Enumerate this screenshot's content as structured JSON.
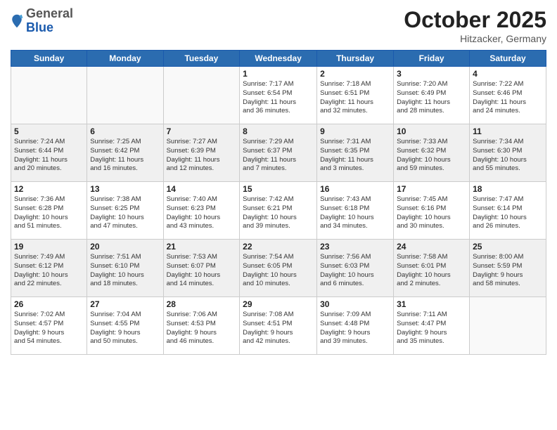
{
  "header": {
    "logo": {
      "general": "General",
      "blue": "Blue"
    },
    "month": "October 2025",
    "location": "Hitzacker, Germany"
  },
  "weekdays": [
    "Sunday",
    "Monday",
    "Tuesday",
    "Wednesday",
    "Thursday",
    "Friday",
    "Saturday"
  ],
  "weeks": [
    [
      {
        "day": "",
        "info": ""
      },
      {
        "day": "",
        "info": ""
      },
      {
        "day": "",
        "info": ""
      },
      {
        "day": "1",
        "info": "Sunrise: 7:17 AM\nSunset: 6:54 PM\nDaylight: 11 hours\nand 36 minutes."
      },
      {
        "day": "2",
        "info": "Sunrise: 7:18 AM\nSunset: 6:51 PM\nDaylight: 11 hours\nand 32 minutes."
      },
      {
        "day": "3",
        "info": "Sunrise: 7:20 AM\nSunset: 6:49 PM\nDaylight: 11 hours\nand 28 minutes."
      },
      {
        "day": "4",
        "info": "Sunrise: 7:22 AM\nSunset: 6:46 PM\nDaylight: 11 hours\nand 24 minutes."
      }
    ],
    [
      {
        "day": "5",
        "info": "Sunrise: 7:24 AM\nSunset: 6:44 PM\nDaylight: 11 hours\nand 20 minutes."
      },
      {
        "day": "6",
        "info": "Sunrise: 7:25 AM\nSunset: 6:42 PM\nDaylight: 11 hours\nand 16 minutes."
      },
      {
        "day": "7",
        "info": "Sunrise: 7:27 AM\nSunset: 6:39 PM\nDaylight: 11 hours\nand 12 minutes."
      },
      {
        "day": "8",
        "info": "Sunrise: 7:29 AM\nSunset: 6:37 PM\nDaylight: 11 hours\nand 7 minutes."
      },
      {
        "day": "9",
        "info": "Sunrise: 7:31 AM\nSunset: 6:35 PM\nDaylight: 11 hours\nand 3 minutes."
      },
      {
        "day": "10",
        "info": "Sunrise: 7:33 AM\nSunset: 6:32 PM\nDaylight: 10 hours\nand 59 minutes."
      },
      {
        "day": "11",
        "info": "Sunrise: 7:34 AM\nSunset: 6:30 PM\nDaylight: 10 hours\nand 55 minutes."
      }
    ],
    [
      {
        "day": "12",
        "info": "Sunrise: 7:36 AM\nSunset: 6:28 PM\nDaylight: 10 hours\nand 51 minutes."
      },
      {
        "day": "13",
        "info": "Sunrise: 7:38 AM\nSunset: 6:25 PM\nDaylight: 10 hours\nand 47 minutes."
      },
      {
        "day": "14",
        "info": "Sunrise: 7:40 AM\nSunset: 6:23 PM\nDaylight: 10 hours\nand 43 minutes."
      },
      {
        "day": "15",
        "info": "Sunrise: 7:42 AM\nSunset: 6:21 PM\nDaylight: 10 hours\nand 39 minutes."
      },
      {
        "day": "16",
        "info": "Sunrise: 7:43 AM\nSunset: 6:18 PM\nDaylight: 10 hours\nand 34 minutes."
      },
      {
        "day": "17",
        "info": "Sunrise: 7:45 AM\nSunset: 6:16 PM\nDaylight: 10 hours\nand 30 minutes."
      },
      {
        "day": "18",
        "info": "Sunrise: 7:47 AM\nSunset: 6:14 PM\nDaylight: 10 hours\nand 26 minutes."
      }
    ],
    [
      {
        "day": "19",
        "info": "Sunrise: 7:49 AM\nSunset: 6:12 PM\nDaylight: 10 hours\nand 22 minutes."
      },
      {
        "day": "20",
        "info": "Sunrise: 7:51 AM\nSunset: 6:10 PM\nDaylight: 10 hours\nand 18 minutes."
      },
      {
        "day": "21",
        "info": "Sunrise: 7:53 AM\nSunset: 6:07 PM\nDaylight: 10 hours\nand 14 minutes."
      },
      {
        "day": "22",
        "info": "Sunrise: 7:54 AM\nSunset: 6:05 PM\nDaylight: 10 hours\nand 10 minutes."
      },
      {
        "day": "23",
        "info": "Sunrise: 7:56 AM\nSunset: 6:03 PM\nDaylight: 10 hours\nand 6 minutes."
      },
      {
        "day": "24",
        "info": "Sunrise: 7:58 AM\nSunset: 6:01 PM\nDaylight: 10 hours\nand 2 minutes."
      },
      {
        "day": "25",
        "info": "Sunrise: 8:00 AM\nSunset: 5:59 PM\nDaylight: 9 hours\nand 58 minutes."
      }
    ],
    [
      {
        "day": "26",
        "info": "Sunrise: 7:02 AM\nSunset: 4:57 PM\nDaylight: 9 hours\nand 54 minutes."
      },
      {
        "day": "27",
        "info": "Sunrise: 7:04 AM\nSunset: 4:55 PM\nDaylight: 9 hours\nand 50 minutes."
      },
      {
        "day": "28",
        "info": "Sunrise: 7:06 AM\nSunset: 4:53 PM\nDaylight: 9 hours\nand 46 minutes."
      },
      {
        "day": "29",
        "info": "Sunrise: 7:08 AM\nSunset: 4:51 PM\nDaylight: 9 hours\nand 42 minutes."
      },
      {
        "day": "30",
        "info": "Sunrise: 7:09 AM\nSunset: 4:48 PM\nDaylight: 9 hours\nand 39 minutes."
      },
      {
        "day": "31",
        "info": "Sunrise: 7:11 AM\nSunset: 4:47 PM\nDaylight: 9 hours\nand 35 minutes."
      },
      {
        "day": "",
        "info": ""
      }
    ]
  ]
}
